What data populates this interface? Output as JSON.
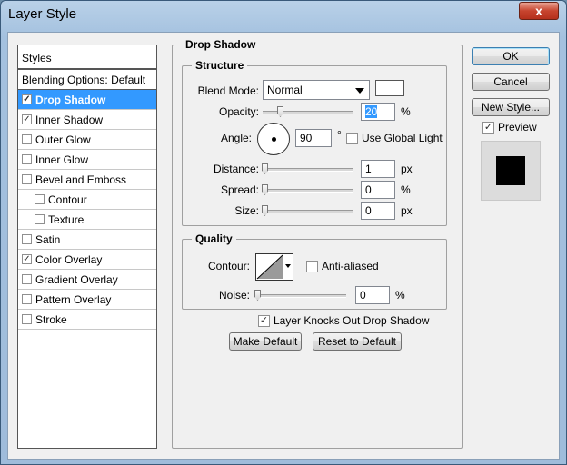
{
  "window": {
    "title": "Layer Style",
    "close": "x"
  },
  "styles": {
    "header": "Styles",
    "blending": "Blending Options: Default",
    "items": [
      {
        "label": "Drop Shadow",
        "checked": true,
        "selected": true,
        "indent": false
      },
      {
        "label": "Inner Shadow",
        "checked": true,
        "selected": false,
        "indent": false
      },
      {
        "label": "Outer Glow",
        "checked": false,
        "selected": false,
        "indent": false
      },
      {
        "label": "Inner Glow",
        "checked": false,
        "selected": false,
        "indent": false
      },
      {
        "label": "Bevel and Emboss",
        "checked": false,
        "selected": false,
        "indent": false
      },
      {
        "label": "Contour",
        "checked": false,
        "selected": false,
        "indent": true
      },
      {
        "label": "Texture",
        "checked": false,
        "selected": false,
        "indent": true
      },
      {
        "label": "Satin",
        "checked": false,
        "selected": false,
        "indent": false
      },
      {
        "label": "Color Overlay",
        "checked": true,
        "selected": false,
        "indent": false
      },
      {
        "label": "Gradient Overlay",
        "checked": false,
        "selected": false,
        "indent": false
      },
      {
        "label": "Pattern Overlay",
        "checked": false,
        "selected": false,
        "indent": false
      },
      {
        "label": "Stroke",
        "checked": false,
        "selected": false,
        "indent": false
      }
    ]
  },
  "panel": {
    "title": "Drop Shadow",
    "structure": {
      "title": "Structure",
      "blend_mode_label": "Blend Mode:",
      "blend_mode_value": "Normal",
      "opacity_label": "Opacity:",
      "opacity_value": "20",
      "opacity_unit": "%",
      "angle_label": "Angle:",
      "angle_value": "90",
      "angle_unit": "°",
      "global_light_label": "Use Global Light",
      "distance_label": "Distance:",
      "distance_value": "1",
      "distance_unit": "px",
      "spread_label": "Spread:",
      "spread_value": "0",
      "spread_unit": "%",
      "size_label": "Size:",
      "size_value": "0",
      "size_unit": "px"
    },
    "quality": {
      "title": "Quality",
      "contour_label": "Contour:",
      "antialiased_label": "Anti-aliased",
      "noise_label": "Noise:",
      "noise_value": "0",
      "noise_unit": "%"
    },
    "knockout_label": "Layer Knocks Out Drop Shadow",
    "make_default": "Make Default",
    "reset_default": "Reset to Default"
  },
  "buttons": {
    "ok": "OK",
    "cancel": "Cancel",
    "new_style": "New Style...",
    "preview": "Preview"
  },
  "check_mark": "✓",
  "colors": {
    "selection": "#3399ff",
    "shadow_color": "#ffffff"
  }
}
